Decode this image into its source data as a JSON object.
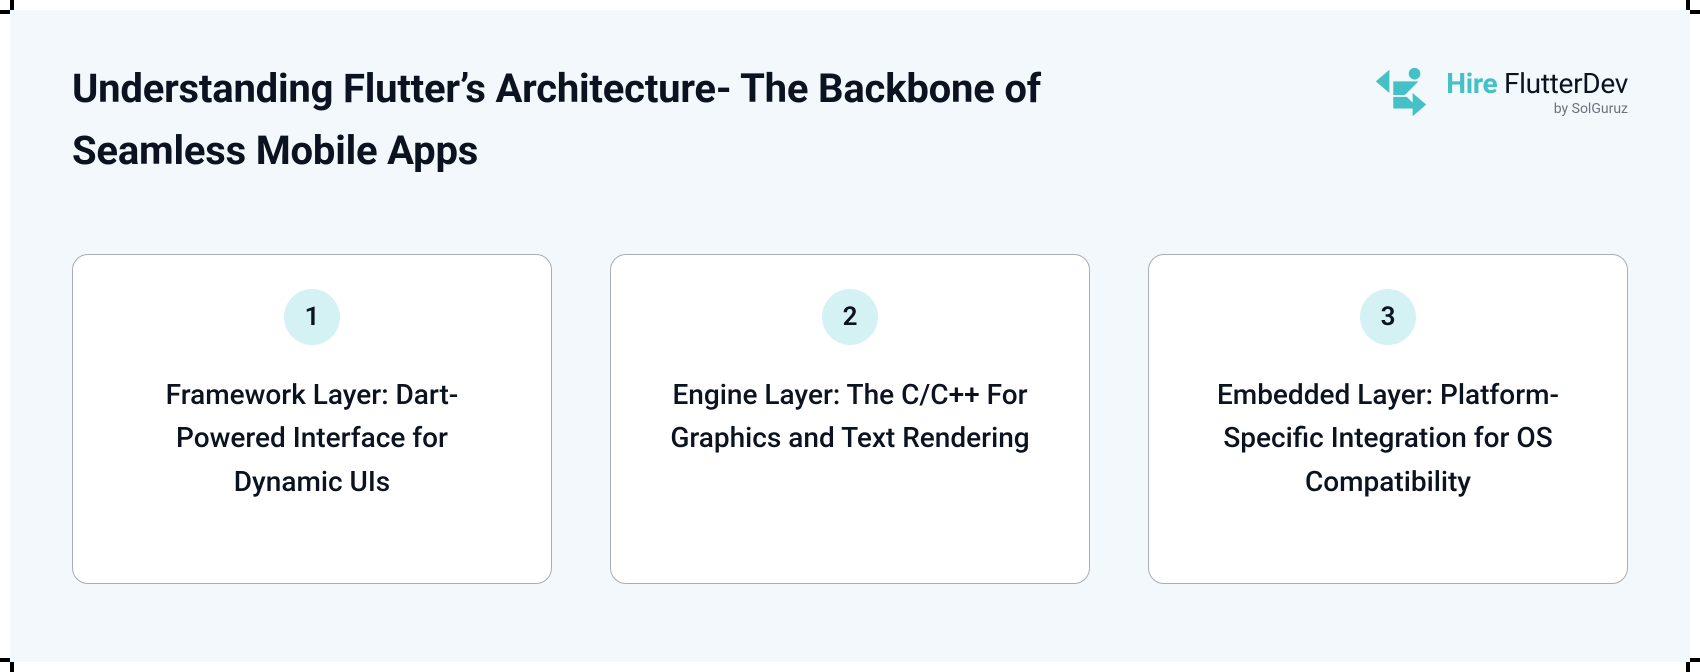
{
  "title": "Understanding Flutter’s Architecture- The Backbone of Seamless Mobile Apps",
  "logo": {
    "brand_bold": "Hire",
    "brand_light": "FlutterDev",
    "byline": "by SolGuruz",
    "accent_color": "#44c1c6"
  },
  "cards": [
    {
      "number": "1",
      "text": "Framework Layer: Dart-Powered Interface for Dynamic UIs"
    },
    {
      "number": "2",
      "text": "Engine Layer: The C/C++ For Graphics and Text Rendering"
    },
    {
      "number": "3",
      "text": "Embedded Layer: Platform-Specific Integration for OS Compatibility"
    }
  ]
}
